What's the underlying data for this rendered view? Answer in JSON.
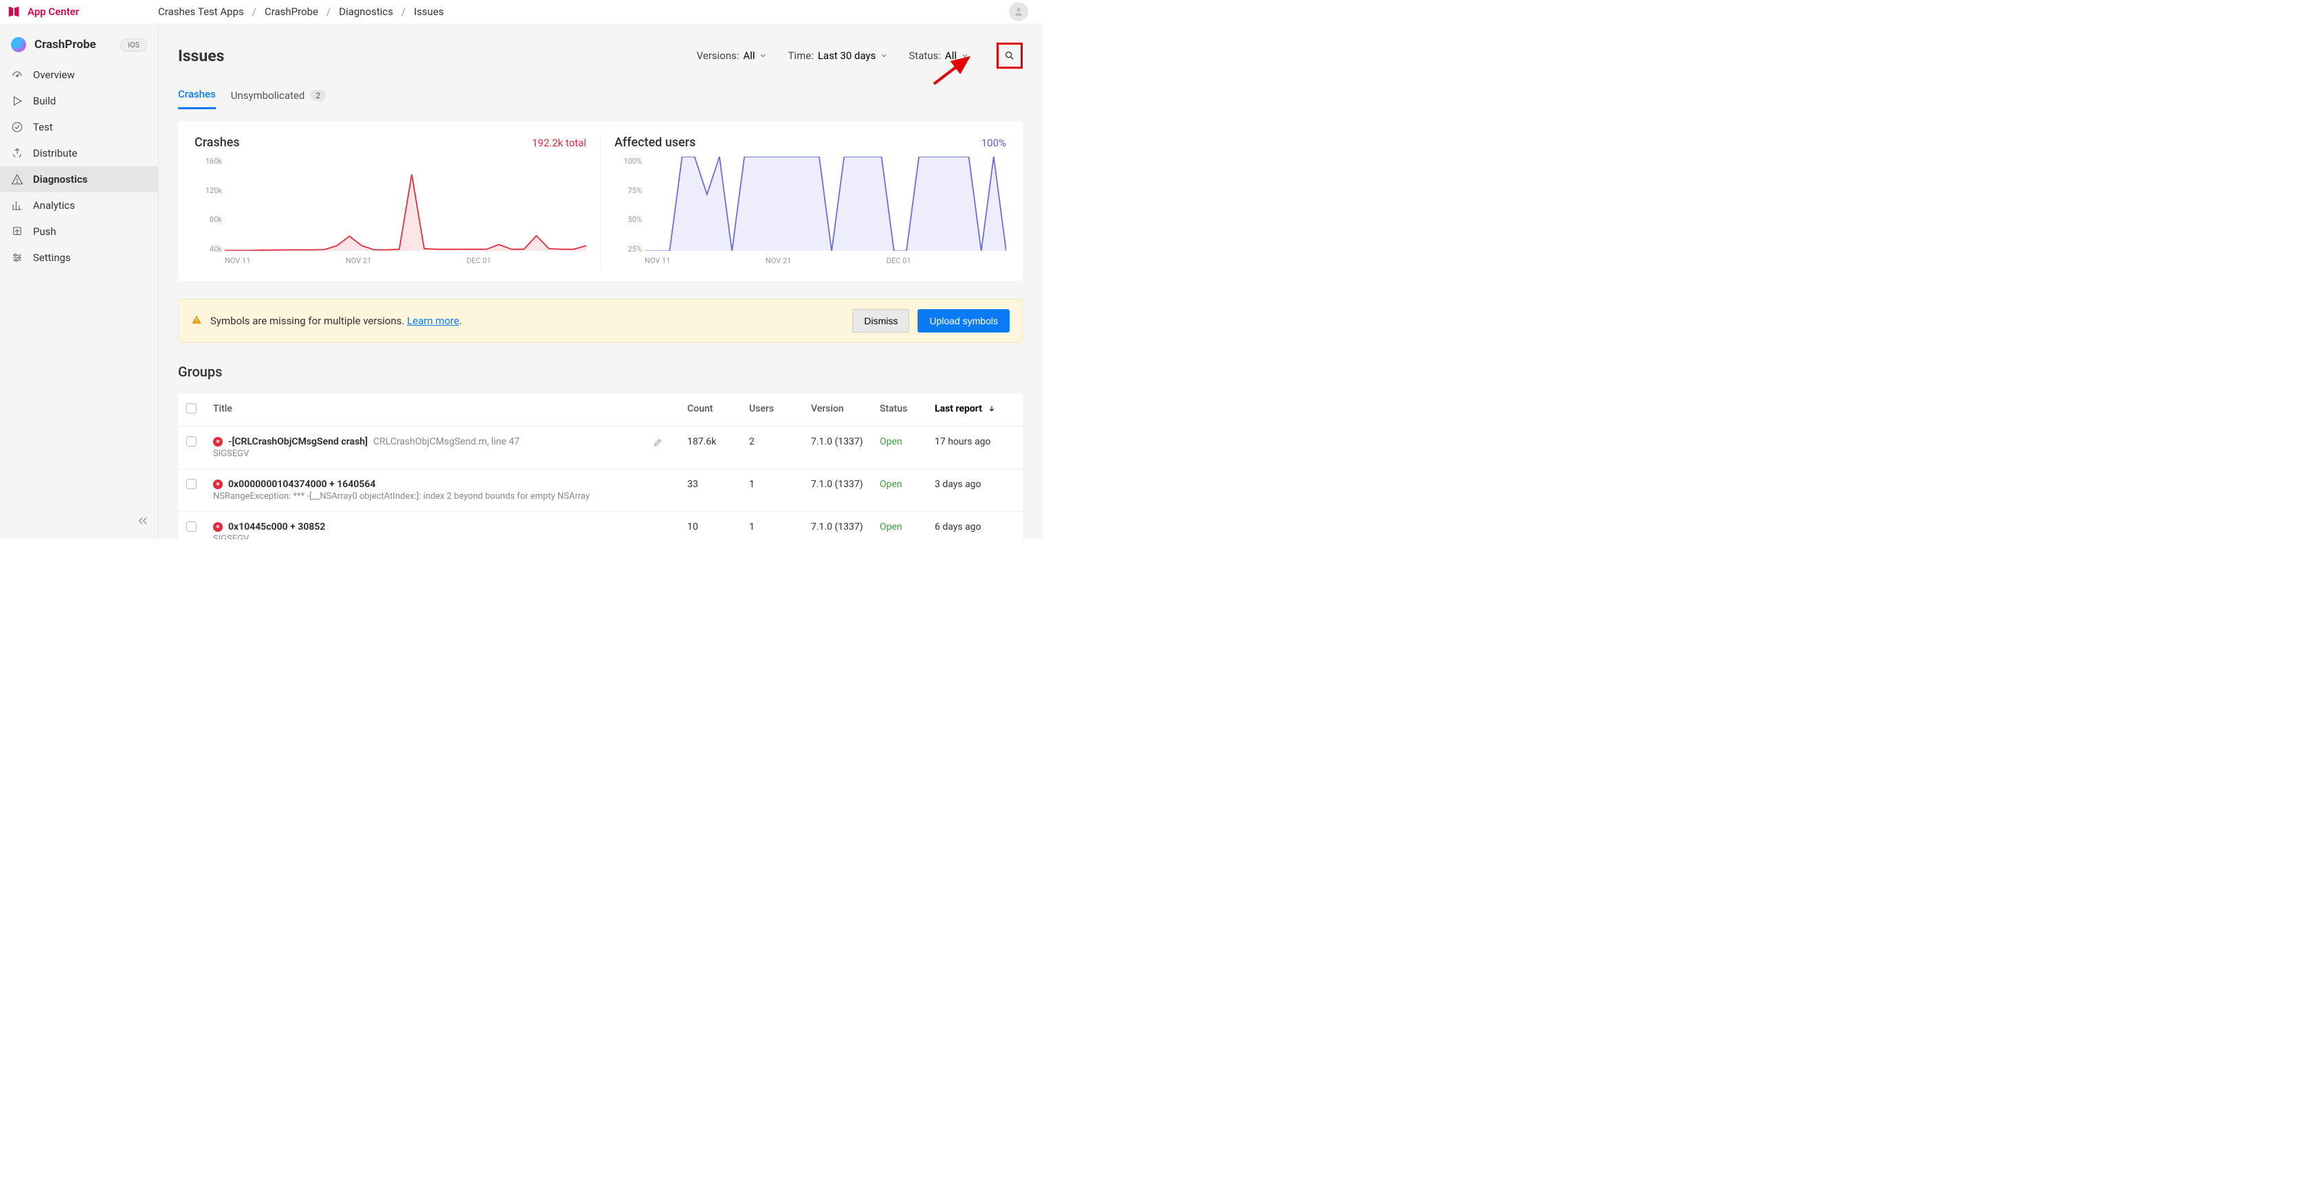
{
  "brand": "App Center",
  "breadcrumb": [
    "Crashes Test Apps",
    "CrashProbe",
    "Diagnostics",
    "Issues"
  ],
  "sidebar": {
    "app_name": "CrashProbe",
    "os_badge": "iOS",
    "items": [
      {
        "label": "Overview"
      },
      {
        "label": "Build"
      },
      {
        "label": "Test"
      },
      {
        "label": "Distribute"
      },
      {
        "label": "Diagnostics",
        "active": true
      },
      {
        "label": "Analytics"
      },
      {
        "label": "Push"
      },
      {
        "label": "Settings"
      }
    ]
  },
  "page": {
    "title": "Issues",
    "filters": {
      "versions_label": "Versions:",
      "versions_value": "All",
      "time_label": "Time:",
      "time_value": "Last 30 days",
      "status_label": "Status:",
      "status_value": "All"
    },
    "tabs": [
      {
        "label": "Crashes",
        "active": true
      },
      {
        "label": "Unsymbolicated",
        "badge": "2"
      }
    ]
  },
  "chart_data": [
    {
      "type": "area",
      "title": "Crashes",
      "total": "192.2k total",
      "ymax": 160000,
      "yticks": [
        "160k",
        "120k",
        "80k",
        "40k"
      ],
      "xticks": [
        "NOV 11",
        "NOV 21",
        "DEC 01"
      ],
      "color": "#e02a3c",
      "x": [
        0,
        1,
        2,
        3,
        4,
        5,
        6,
        7,
        8,
        9,
        10,
        11,
        12,
        13,
        14,
        15,
        16,
        17,
        18,
        19,
        20,
        21,
        22,
        23,
        24,
        25,
        26,
        27,
        28,
        29
      ],
      "values": [
        1000,
        1000,
        1000,
        1500,
        1500,
        2000,
        2000,
        2000,
        2500,
        9000,
        25000,
        9000,
        2000,
        2000,
        3000,
        130000,
        4000,
        3000,
        3000,
        3000,
        3000,
        3000,
        11000,
        3000,
        3000,
        26000,
        4000,
        3000,
        3000,
        9000
      ]
    },
    {
      "type": "area",
      "title": "Affected users",
      "total": "100%",
      "ymax": 100,
      "yticks": [
        "100%",
        "75%",
        "50%",
        "25%"
      ],
      "xticks": [
        "NOV 11",
        "NOV 21",
        "DEC 01"
      ],
      "color": "#6a6ae0",
      "x": [
        0,
        1,
        2,
        3,
        4,
        5,
        6,
        7,
        8,
        9,
        10,
        11,
        12,
        13,
        14,
        15,
        16,
        17,
        18,
        19,
        20,
        21,
        22,
        23,
        24,
        25,
        26,
        27,
        28,
        29
      ],
      "values": [
        0,
        0,
        0,
        100,
        100,
        60,
        100,
        0,
        100,
        100,
        100,
        100,
        100,
        100,
        100,
        0,
        100,
        100,
        100,
        100,
        0,
        0,
        100,
        100,
        100,
        100,
        100,
        0,
        100,
        0
      ]
    }
  ],
  "banner": {
    "text": "Symbols are missing for multiple versions. ",
    "link": "Learn more",
    "dot": ".",
    "dismiss": "Dismiss",
    "upload": "Upload symbols"
  },
  "groups": {
    "title": "Groups",
    "columns": [
      "Title",
      "Count",
      "Users",
      "Version",
      "Status",
      "Last report"
    ],
    "rows": [
      {
        "main": "-[CRLCrashObjCMsgSend crash]",
        "detail": "CRLCrashObjCMsgSend.m, line 47",
        "subtype": "SIGSEGV",
        "count": "187.6k",
        "users": "2",
        "version": "7.1.0 (1337)",
        "status": "Open",
        "last": "17 hours ago",
        "editable": true
      },
      {
        "main": "0x0000000104374000 + 1640564",
        "detail": "",
        "subtype": "NSRangeException: *** -[__NSArray0 objectAtIndex:]: index 2 beyond bounds for empty NSArray",
        "count": "33",
        "users": "1",
        "version": "7.1.0 (1337)",
        "status": "Open",
        "last": "3 days ago"
      },
      {
        "main": "0x10445c000 + 30852",
        "detail": "",
        "subtype": "SIGSEGV",
        "count": "10",
        "users": "1",
        "version": "7.1.0 (1337)",
        "status": "Open",
        "last": "6 days ago"
      }
    ]
  }
}
